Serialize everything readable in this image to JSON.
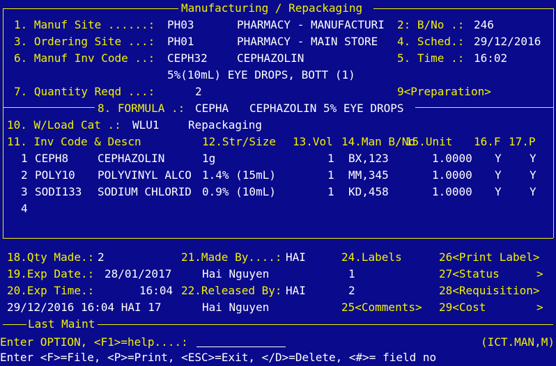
{
  "title": "Manufacturing / Repackaging",
  "header": {
    "f1_label": "1. Manuf Site ......:",
    "f1_code": "PH03",
    "f1_name": "PHARMACY - MANUFACTURI",
    "f2_label": "2: B/No .:",
    "f2_value": "246",
    "f3_label": "3. Ordering Site ...:",
    "f3_code": "PH01",
    "f3_name": "PHARMACY - MAIN STORE",
    "f4_label": "4. Sched.:",
    "f4_value": "29/12/2016",
    "f6_label": "6. Manuf Inv Code ..:",
    "f6_code": "CEPH32",
    "f6_name": "CEPHAZOLIN",
    "f5_label": "5. Time .:",
    "f5_value": "16:02",
    "f6_desc": "5%(10mL) EYE DROPS, BOTT (1)",
    "f7_label": "7. Quantity Reqd ...:",
    "f7_value": "2",
    "f9_label": "9<Preparation>"
  },
  "formula": {
    "label": "8. FORMULA .:",
    "code": "CEPHA",
    "name": "CEPHAZOLIN 5% EYE DROPS"
  },
  "wload": {
    "label": "10. W/Load Cat .:",
    "code": "WLU1",
    "name": "Repackaging"
  },
  "table": {
    "h_inv": "11. Inv Code & Descn",
    "h_str": "12.Str/Size",
    "h_vol": "13.Vol",
    "h_man": "14.Man B/No",
    "h_unit": "15.Unit",
    "h_f": "16.F",
    "h_p": "17.P",
    "rows": [
      {
        "n": "1",
        "code": "CEPH8",
        "desc": "CEPHAZOLIN",
        "str": "1g",
        "vol": "1",
        "bno": "BX,123",
        "unit": "1.0000",
        "f": "Y",
        "p": "Y"
      },
      {
        "n": "2",
        "code": "POLY10",
        "desc": "POLYVINYL ALCO",
        "str": "1.4% (15mL)",
        "vol": "1",
        "bno": "MM,345",
        "unit": "1.0000",
        "f": "Y",
        "p": "Y"
      },
      {
        "n": "3",
        "code": "SODI133",
        "desc": "SODIUM CHLORID",
        "str": "0.9% (10mL)",
        "vol": "1",
        "bno": "KD,458",
        "unit": "1.0000",
        "f": "Y",
        "p": "Y"
      }
    ],
    "empty_row": "4"
  },
  "footer": {
    "qty_made_label": "18.Qty Made.:",
    "qty_made_value": "2",
    "made_by_label": "21.Made By....:",
    "made_by_value": "HAI",
    "labels_label": "24.Labels",
    "print_label": "26<Print Label>",
    "exp_date_label": "19.Exp Date.:",
    "exp_date_value": "28/01/2017",
    "made_by_name": "Hai Nguyen",
    "labels_value1": "1",
    "status": "27<Status",
    "status_end": ">",
    "exp_time_label": "20.Exp Time.:",
    "exp_time_value": "16:04",
    "released_label": "22.Released By:",
    "released_value": "HAI",
    "labels_value2": "2",
    "requisition": "28<Requisition>",
    "maint_text": "29/12/2016 16:04 HAI 17",
    "released_name": "Hai Nguyen",
    "comments": "25<Comments>",
    "cost": "29<Cost",
    "cost_end": ">",
    "last_maint": "Last Maint"
  },
  "command": {
    "prompt": "Enter OPTION, <F1>=help....:",
    "input_value": "",
    "program": "(ICT.MAN,M)",
    "help_line": "Enter <F>=File, <P>=Print, <ESC>=Exit, </D>=Delete, <#>= field no"
  },
  "colors": {
    "background": "#0a0a8c",
    "label": "#f2f200",
    "value": "#ffffff"
  }
}
